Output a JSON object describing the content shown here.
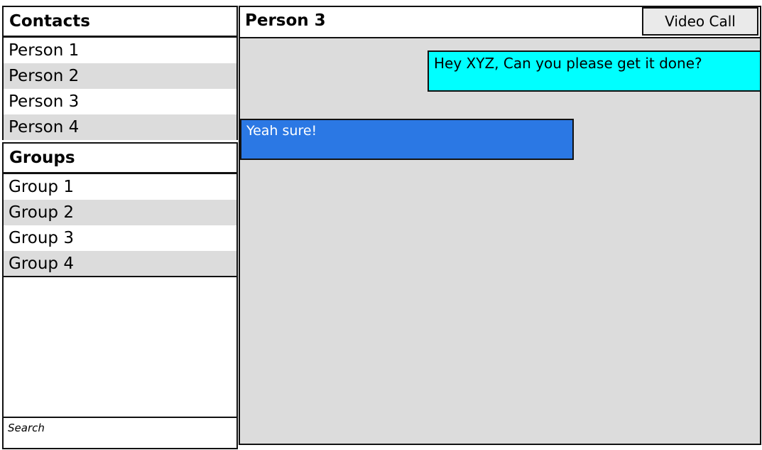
{
  "sidebar": {
    "contacts_title": "Contacts",
    "contacts": [
      {
        "label": "Person 1"
      },
      {
        "label": "Person 2"
      },
      {
        "label": "Person 3"
      },
      {
        "label": "Person 4"
      }
    ],
    "groups_title": "Groups",
    "groups": [
      {
        "label": "Group 1"
      },
      {
        "label": "Group 2"
      },
      {
        "label": "Group 3"
      },
      {
        "label": "Group 4"
      }
    ],
    "search": {
      "placeholder": "Search",
      "value": ""
    }
  },
  "chat": {
    "title": "Person 3",
    "video_call_label": "Video Call",
    "messages": [
      {
        "direction": "sent",
        "text": "Hey XYZ, Can you please get it done?"
      },
      {
        "direction": "received",
        "text": "Yeah sure!"
      }
    ]
  },
  "colors": {
    "sent_bubble": "#00ffff",
    "received_bubble": "#2b78e4",
    "alt_row": "#dcdcdc",
    "chat_background": "#dcdcdc"
  }
}
